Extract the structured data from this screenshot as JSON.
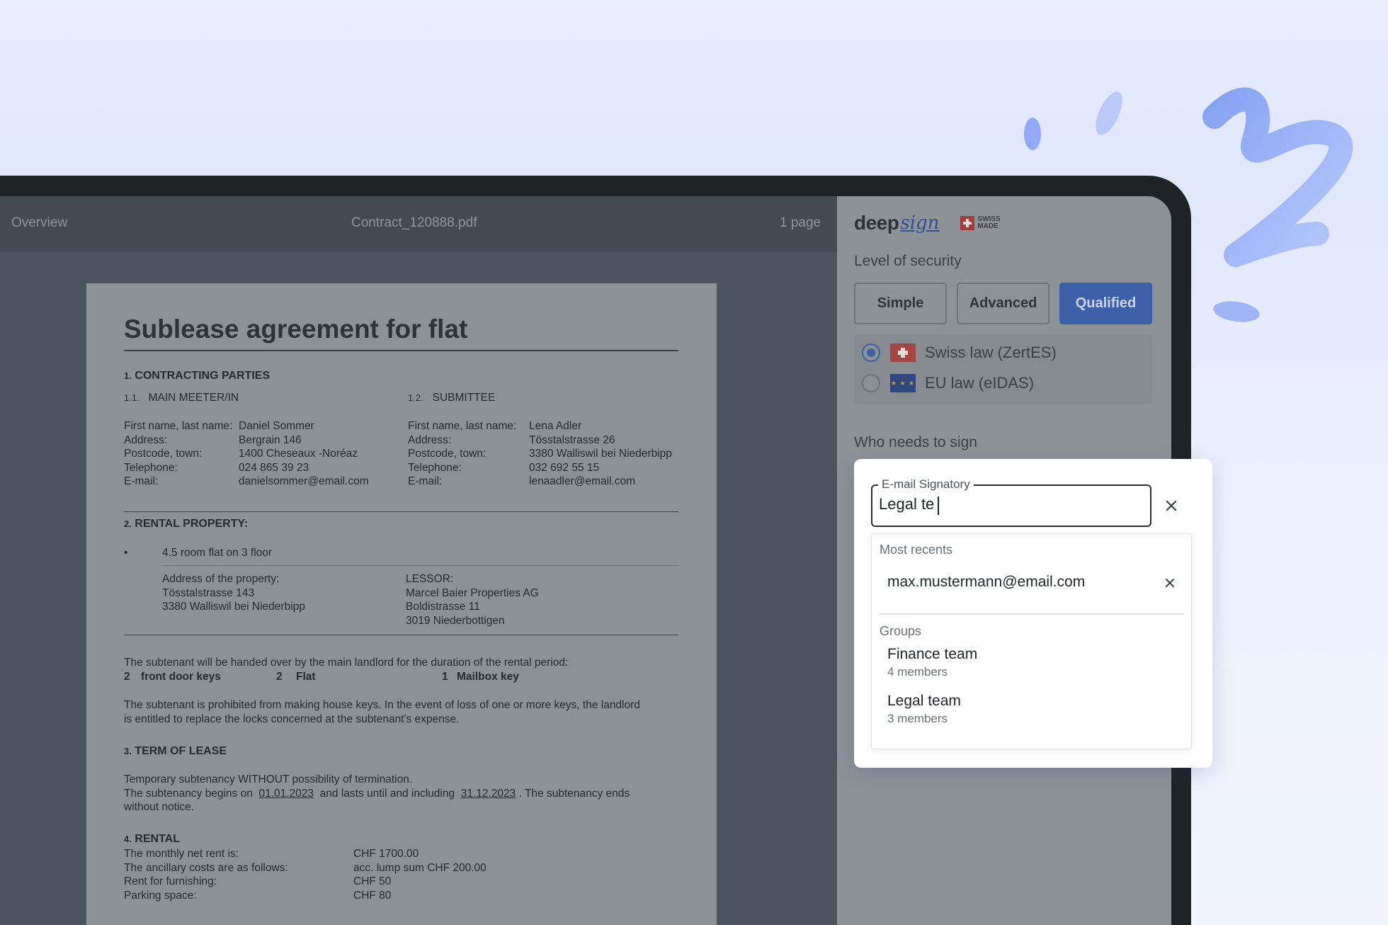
{
  "viewer": {
    "overview_label": "Overview",
    "file_name": "Contract_120888.pdf",
    "page_count": "1 page"
  },
  "document": {
    "title": "Sublease agreement for flat",
    "s1_num": "1.",
    "s1_title": "CONTRACTING PARTIES",
    "s11_num": "1.1.",
    "s11_title": "MAIN MEETER/IN",
    "s12_num": "1.2.",
    "s12_title": "SUBMITTEE",
    "labels": [
      "First name, last name:",
      "Address:",
      "Postcode, town:",
      "Telephone:",
      "E-mail:"
    ],
    "main": [
      "Daniel Sommer",
      "Bergrain 146",
      "1400 Cheseaux -Noréaz",
      "024 865 39 23",
      "danielsommer@email.com"
    ],
    "sub": [
      "Lena Adler",
      "Tösstalstrasse 26",
      "3380 Walliswil bei Niederbipp",
      "032 692 55 15",
      "lenaadler@email.com"
    ],
    "s2_num": "2.",
    "s2_title": "RENTAL PROPERTY:",
    "bullet": "•",
    "flat": "4.5 room flat on 3 floor",
    "address_label": "Address of the property:",
    "address": [
      "Tösstalstrasse 143",
      "3380 Walliswil bei  Niederbipp"
    ],
    "lessor_label": "LESSOR:",
    "lessor": [
      "Marcel Baier Properties AG",
      "Boldistrasse 11",
      "3019 Niederbottigen"
    ],
    "handover": "The subtenant will be  handed over by the main landlord for the duration of the rental period:",
    "keys": [
      {
        "count": "2",
        "label": "front door keys"
      },
      {
        "count": "2",
        "label": "Flat"
      },
      {
        "count": "1",
        "label": "Mailbox key"
      }
    ],
    "prohibited_1": "The subtenant is prohibited from making house keys. In the event of loss of one or more keys, the landlord",
    "prohibited_2": "is entitled to replace the locks concerned at the subtenant's expense.",
    "s3_num": "3.",
    "s3_title": "TERM OF LEASE",
    "term_1": "Temporary subtenancy WITHOUT possibility of termination.",
    "term_2a": "The subtenancy begins on",
    "term_start": "01.01.2023",
    "term_2b": "and lasts until and including",
    "term_end": "31.12.2023",
    "term_2c": ". The subtenancy ends",
    "term_3": "without notice.",
    "s4_num": "4.",
    "s4_title": "RENTAL",
    "rent_labels": [
      "The monthly net rent is:",
      "The ancillary costs are as follows:",
      "Rent for furnishing:",
      "Parking space:"
    ],
    "rent_values": [
      "CHF 1700.00",
      "acc. lump sum CHF  200.00",
      "CHF 50",
      "CHF 80"
    ]
  },
  "panel": {
    "brand_word": "deep",
    "brand_script": "sign",
    "swiss_made": "SWISS MADE",
    "level_label": "Level of security",
    "levels": [
      "Simple",
      "Advanced",
      "Qualified"
    ],
    "active_level": "Qualified",
    "laws": [
      {
        "label": "Swiss law (ZertES)",
        "selected": true
      },
      {
        "label": "EU law (eIDAS)",
        "selected": false
      }
    ],
    "eu_stars": "★ ★ ★",
    "who_label": "Who needs to sign"
  },
  "popup": {
    "field_label": "E-mail Signatory",
    "field_value": "Legal te",
    "recents_header": "Most recents",
    "recents": [
      "max.mustermann@email.com"
    ],
    "groups_header": "Groups",
    "groups": [
      {
        "name": "Finance team",
        "members": "4 members"
      },
      {
        "name": "Legal team",
        "members": "3 members"
      }
    ]
  },
  "colors": {
    "accent": "#3d5fa8",
    "decoration": "#9eb6f6"
  }
}
